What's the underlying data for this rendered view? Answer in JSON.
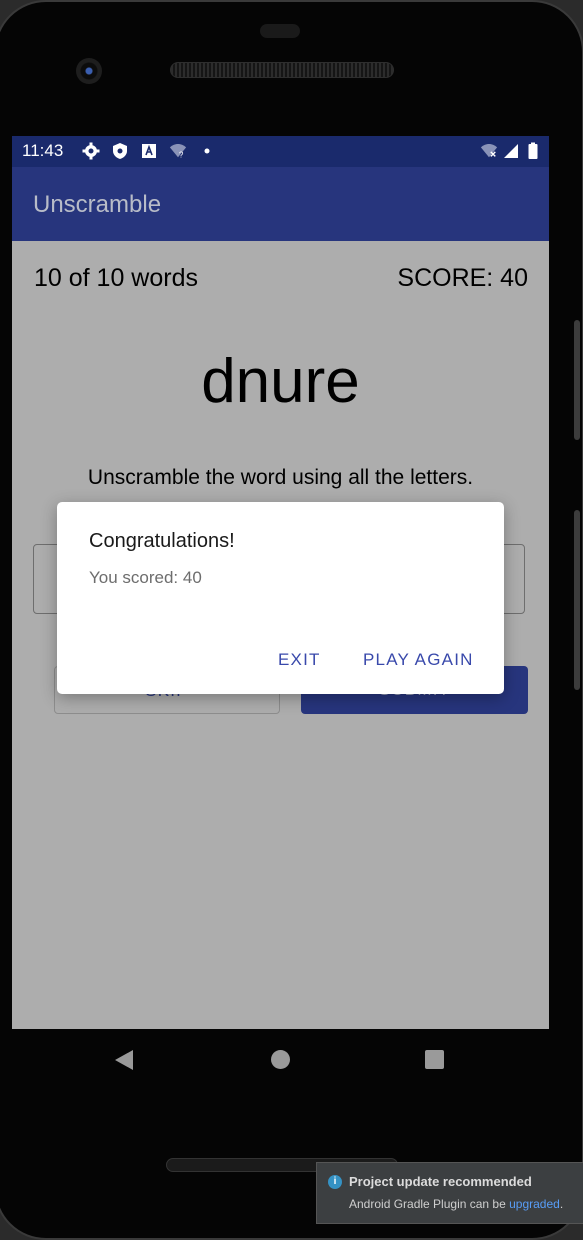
{
  "status_bar": {
    "time": "11:43",
    "left_icons": [
      "gear-icon",
      "shield-icon",
      "a-box-icon",
      "wifi-question-icon",
      "dot-icon"
    ],
    "right_icons": [
      "wifi-off-icon",
      "signal-icon",
      "battery-icon"
    ]
  },
  "app_bar": {
    "title": "Unscramble"
  },
  "game": {
    "word_count": "10 of 10 words",
    "score": "SCORE: 40",
    "scrambled_word": "dnure",
    "instructions": "Unscramble the word using all the letters.",
    "skip_label": "SKIP",
    "submit_label": "SUBMIT"
  },
  "dialog": {
    "title": "Congratulations!",
    "message": "You scored: 40",
    "exit_label": "EXIT",
    "play_again_label": "PLAY AGAIN"
  },
  "navigation": [
    "back-icon",
    "home-icon",
    "recents-icon"
  ],
  "notification": {
    "title": "Project update recommended",
    "body_prefix": "Android Gradle Plugin can be ",
    "link_text": "upgraded",
    "body_suffix": "."
  },
  "colors": {
    "status_bar": "#1a2a6c",
    "app_bar": "#27357d",
    "screen_scrim": "#adadad",
    "dialog_button": "#3949ab",
    "notification_bg": "#3c3f41",
    "link": "#589df6"
  }
}
